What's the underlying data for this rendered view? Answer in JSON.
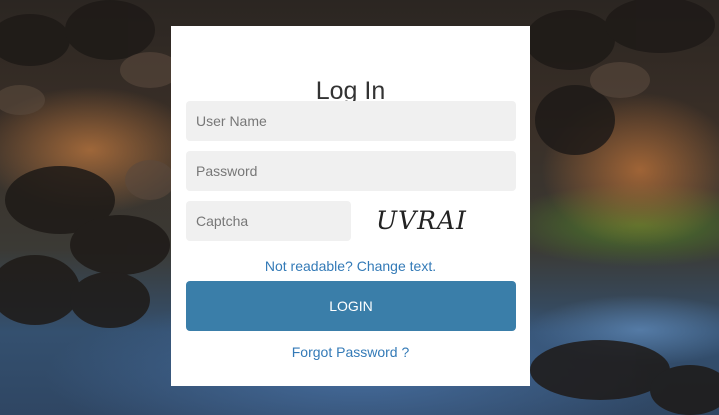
{
  "login": {
    "title": "Log In",
    "username_placeholder": "User Name",
    "password_placeholder": "Password",
    "captcha_placeholder": "Captcha",
    "captcha_text": "UVRAI",
    "change_text_link": "Not readable? Change text.",
    "login_button": "LOGIN",
    "forgot_password_link": "Forgot Password ?"
  },
  "colors": {
    "card": "#ffffff",
    "input_bg": "#f0f0f0",
    "button": "#3a7ea9",
    "link": "#337ab7"
  }
}
